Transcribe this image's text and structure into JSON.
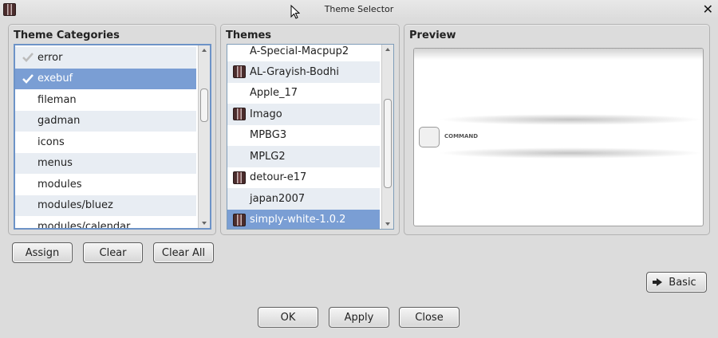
{
  "window": {
    "title": "Theme Selector",
    "close_glyph": "✕"
  },
  "categories": {
    "label": "Theme Categories",
    "items": [
      {
        "label": "error",
        "checked": "faded"
      },
      {
        "label": "exebuf",
        "checked": "yes"
      },
      {
        "label": "fileman"
      },
      {
        "label": "gadman"
      },
      {
        "label": "icons"
      },
      {
        "label": "menus"
      },
      {
        "label": "modules"
      },
      {
        "label": "modules/bluez"
      },
      {
        "label": "modules/calendar"
      }
    ],
    "selected": "exebuf"
  },
  "themes": {
    "label": "Themes",
    "items": [
      {
        "label": "A-Special-Macpup2",
        "icon": "none"
      },
      {
        "label": "AL-Grayish-Bodhi",
        "icon": "theme-icon"
      },
      {
        "label": "Apple_17",
        "icon": "none"
      },
      {
        "label": "Imago",
        "icon": "theme-icon"
      },
      {
        "label": "MPBG3",
        "icon": "none"
      },
      {
        "label": "MPLG2",
        "icon": "none"
      },
      {
        "label": "detour-e17",
        "icon": "theme-icon"
      },
      {
        "label": "japan2007",
        "icon": "none"
      },
      {
        "label": "simply-white-1.0.2",
        "icon": "theme-icon"
      }
    ],
    "selected": "simply-white-1.0.2"
  },
  "preview": {
    "label": "Preview",
    "command_label": "COMMAND"
  },
  "category_buttons": {
    "assign": "Assign",
    "clear": "Clear",
    "clear_all": "Clear All"
  },
  "basic_button": "Basic",
  "footer_buttons": {
    "ok": "OK",
    "apply": "Apply",
    "close": "Close"
  },
  "colors": {
    "selection": "#7a9ed4",
    "alt_row": "#e8edf3",
    "background": "#dcdcdc"
  }
}
